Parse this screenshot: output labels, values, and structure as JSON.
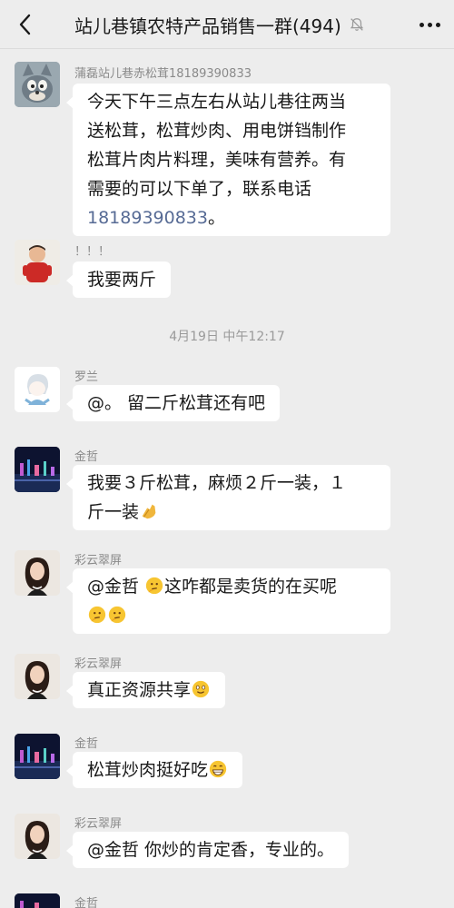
{
  "header": {
    "title": "站儿巷镇农特产品销售一群(494)"
  },
  "timestamp": "4月19日 中午12:17",
  "messages": [
    {
      "sender": "蒲磊站儿巷赤松茸18189390833",
      "lines": [
        "今天下午三点左右从站儿巷往两当",
        "送松茸，松茸炒肉、用电饼铛制作",
        "松茸片肉片料理，美味有营养。有",
        "需要的可以下单了，联系电话"
      ],
      "phone": "18189390833",
      "tail": "。"
    },
    {
      "sender": "！！！",
      "text": "我要两斤"
    },
    {
      "sender": "罗兰",
      "text": "@。 留二斤松茸还有吧"
    },
    {
      "sender": "金哲",
      "line1": "我要３斤松茸，麻烦２斤一装，１",
      "line2": "斤一装"
    },
    {
      "sender": "彩云翠屏",
      "line1": "@金哲 ",
      "line1b": "这咋都是卖货的在买呢"
    },
    {
      "sender": "彩云翠屏",
      "text": "真正资源共享"
    },
    {
      "sender": "金哲",
      "text": "松茸炒肉挺好吃"
    },
    {
      "sender": "彩云翠屏",
      "text": "@金哲 你炒的肯定香，专业的。"
    },
    {
      "sender": "金哲"
    }
  ],
  "icons": {
    "back": "chevron-left-icon",
    "mute": "bell-muted-icon",
    "more": "more-dots-icon",
    "emoji_thinking": "thinking-face-emoji",
    "emoji_clap": "clapping-hands-emoji",
    "emoji_smile": "smiling-face-emoji",
    "emoji_grin": "grinning-face-emoji"
  },
  "colors": {
    "background": "#ededed",
    "bubble": "#ffffff",
    "link": "#576b95",
    "meta_text": "#8a8a8a"
  }
}
